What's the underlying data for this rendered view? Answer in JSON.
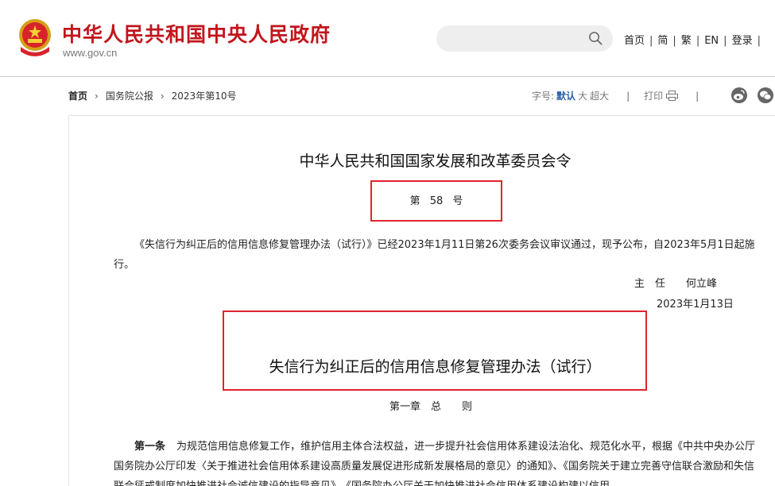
{
  "header": {
    "site_title": "中华人民共和国中央人民政府",
    "domain": "www.gov.cn",
    "search": {
      "placeholder": ""
    },
    "nav": [
      "首页",
      "简",
      "繁",
      "EN",
      "登录"
    ],
    "accent_color": "#c1161c"
  },
  "breadcrumb": {
    "items": [
      "首页",
      "国务院公报",
      "2023年第10号"
    ]
  },
  "tools": {
    "font_size_label": "字号:",
    "sizes": [
      "默认",
      "大",
      "超大"
    ],
    "active_size": "默认",
    "print_label": "打印"
  },
  "article": {
    "title": "中华人民共和国国家发展和改革委员会令",
    "order_number": "第 58 号",
    "intro": "《失信行为纠正后的信用信息修复管理办法（试行）》已经2023年1月11日第26次委务会议审议通过，现予公布，自2023年5月1日起施行。",
    "signer": "主　任　　何立峰",
    "date": "2023年1月13日",
    "law_title": "失信行为纠正后的信用信息修复管理办法（试行）",
    "chapter": "第一章　总　　则",
    "article1_label": "第一条",
    "article1_text": "为规范信用信息修复工作，维护信用主体合法权益，进一步提升社会信用体系建设法治化、规范化水平，根据《中共中央办公厅 国务院办公厅印发〈关于推进社会信用体系建设高质量发展促进形成新发展格局的意见〉的通知》、《国务院关于建立完善守信联合激励和失信联合惩戒制度加快推进社会诚信建设的指导意见》、《国务院办公厅关于加快推进社会信用体系建设构建以信用",
    "highlight_color": "#e0242e"
  }
}
